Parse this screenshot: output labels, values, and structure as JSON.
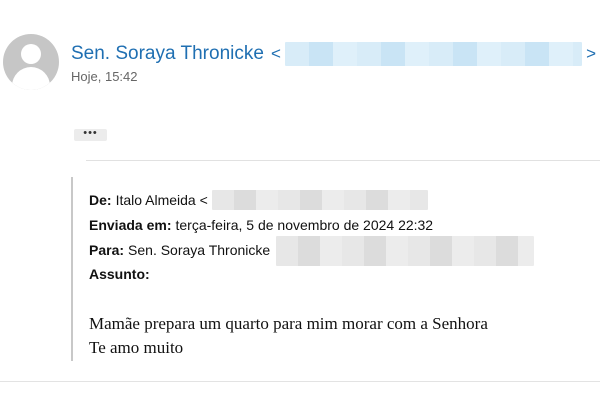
{
  "message": {
    "sender_name": "Sen. Soraya Thronicke",
    "sender_open_bracket": "<",
    "sender_close_bracket": ">",
    "timestamp": "Hoje, 15:42",
    "show_more_label": "•••"
  },
  "quoted": {
    "from_label": "De:",
    "from_value": "Italo Almeida <",
    "sent_label": "Enviada em:",
    "sent_value": "terça-feira, 5 de novembro de 2024 22:32",
    "to_label": "Para:",
    "to_value": "Sen. Soraya Thronicke",
    "subject_label": "Assunto:",
    "subject_value": ""
  },
  "body": {
    "line1": "Mamãe prepara um quarto para mim morar com a Senhora",
    "line2": "Te amo muito"
  },
  "colors": {
    "sender_link": "#1f6fb2",
    "avatar_bg": "#c6c6c6"
  }
}
